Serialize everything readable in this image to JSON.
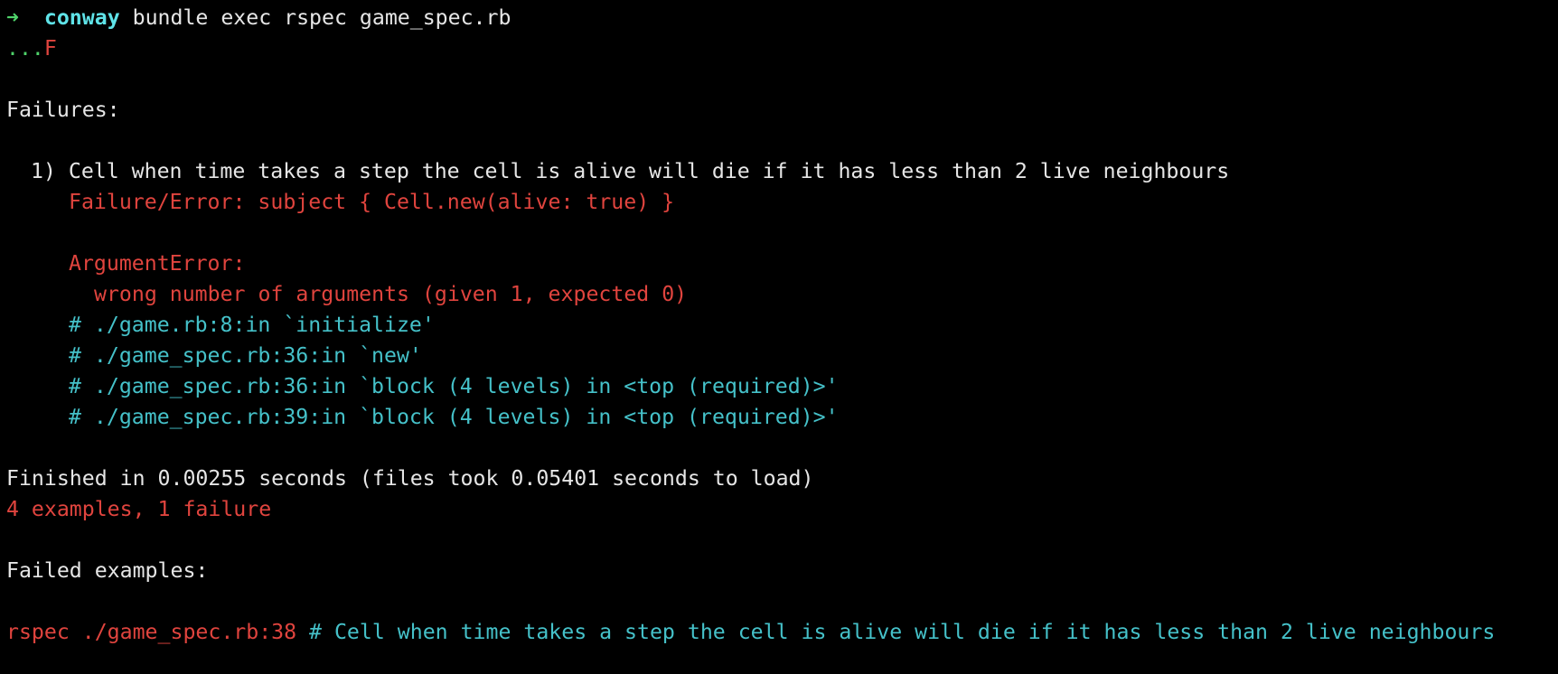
{
  "terminal": {
    "prompt": {
      "arrow": "➜",
      "directory": "conway",
      "command": " bundle exec rspec game_spec.rb"
    },
    "progress": {
      "passed": "...",
      "failed": "F"
    },
    "failures_header": "Failures:",
    "failure_1": {
      "title": "1) Cell when time takes a step the cell is alive will die if it has less than 2 live neighbours",
      "error_line": "Failure/Error: subject { Cell.new(alive: true) }",
      "exception": "ArgumentError:",
      "message": "wrong number of arguments (given 1, expected 0)",
      "backtrace": [
        "# ./game.rb:8:in `initialize'",
        "# ./game_spec.rb:36:in `new'",
        "# ./game_spec.rb:36:in `block (4 levels) in <top (required)>'",
        "# ./game_spec.rb:39:in `block (4 levels) in <top (required)>'"
      ]
    },
    "finished": "Finished in 0.00255 seconds (files took 0.05401 seconds to load)",
    "summary": "4 examples, 1 failure",
    "failed_examples_header": "Failed examples:",
    "failed_example": {
      "command": "rspec ./game_spec.rb:38",
      "comment": " # Cell when time takes a step the cell is alive will die if it has less than 2 live neighbours"
    }
  },
  "colors": {
    "background": "#000000",
    "text": "#e6e6e6",
    "prompt_arrow": "#4fd36a",
    "prompt_directory": "#5fe3e8",
    "error": "#e0443e",
    "backtrace": "#45c1c9"
  }
}
